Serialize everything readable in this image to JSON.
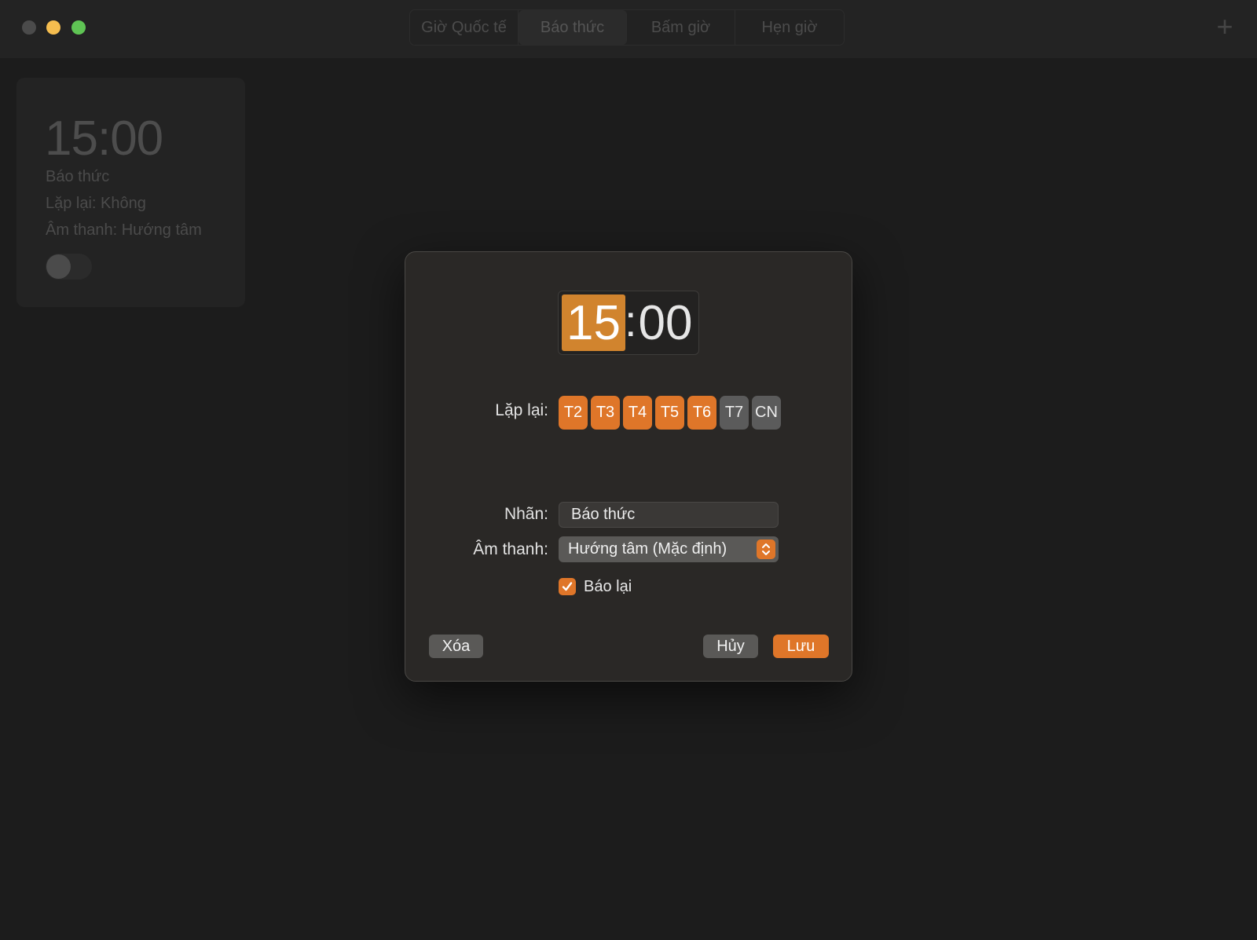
{
  "window": {
    "tabs": [
      {
        "label": "Giờ Quốc tế"
      },
      {
        "label": "Báo thức"
      },
      {
        "label": "Bấm giờ"
      },
      {
        "label": "Hẹn giờ"
      }
    ],
    "active_tab": "Báo thức",
    "add_label": "+"
  },
  "alarm_card": {
    "time": "15:00",
    "label": "Báo thức",
    "repeat": "Lặp lại: Không",
    "sound": "Âm thanh: Hướng tâm",
    "enabled": false
  },
  "dialog": {
    "time": {
      "hour": "15",
      "separator": ":",
      "minute": "00"
    },
    "repeat_label": "Lặp lại:",
    "days": [
      {
        "label": "T2",
        "selected": true
      },
      {
        "label": "T3",
        "selected": true
      },
      {
        "label": "T4",
        "selected": true
      },
      {
        "label": "T5",
        "selected": true
      },
      {
        "label": "T6",
        "selected": true
      },
      {
        "label": "T7",
        "selected": false
      },
      {
        "label": "CN",
        "selected": false
      }
    ],
    "name_label": "Nhãn:",
    "name_value": "Báo thức",
    "sound_label": "Âm thanh:",
    "sound_value": "Hướng tâm (Mặc định)",
    "snooze_label": "Báo lại",
    "snooze_checked": true,
    "delete_label": "Xóa",
    "cancel_label": "Hủy",
    "save_label": "Lưu"
  },
  "colors": {
    "accent": "#df7629",
    "time_highlight": "#d1842e",
    "background": "#1c1c1c",
    "dialog_bg": "#2a2826"
  }
}
